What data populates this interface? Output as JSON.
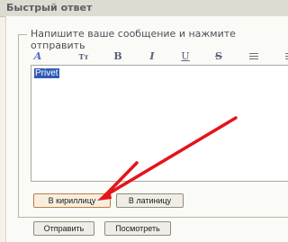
{
  "header": {
    "title": "Быстрый ответ"
  },
  "form": {
    "legend": "Напишите ваше сообщение и нажмите отправить",
    "toolbar": {
      "size_label": "Тт",
      "bold_label": "B",
      "italic_label": "I",
      "underline_label": "U",
      "strike_label": "S",
      "color_label": "A"
    },
    "editor_text": "Privet",
    "cyrillic_button": "В кириллицу",
    "latin_button": "В латиницу",
    "send_button": "Отправить",
    "preview_button": "Посмотреть"
  },
  "colors": {
    "arrow": "#e4141b",
    "selection": "#2f5bb7"
  }
}
